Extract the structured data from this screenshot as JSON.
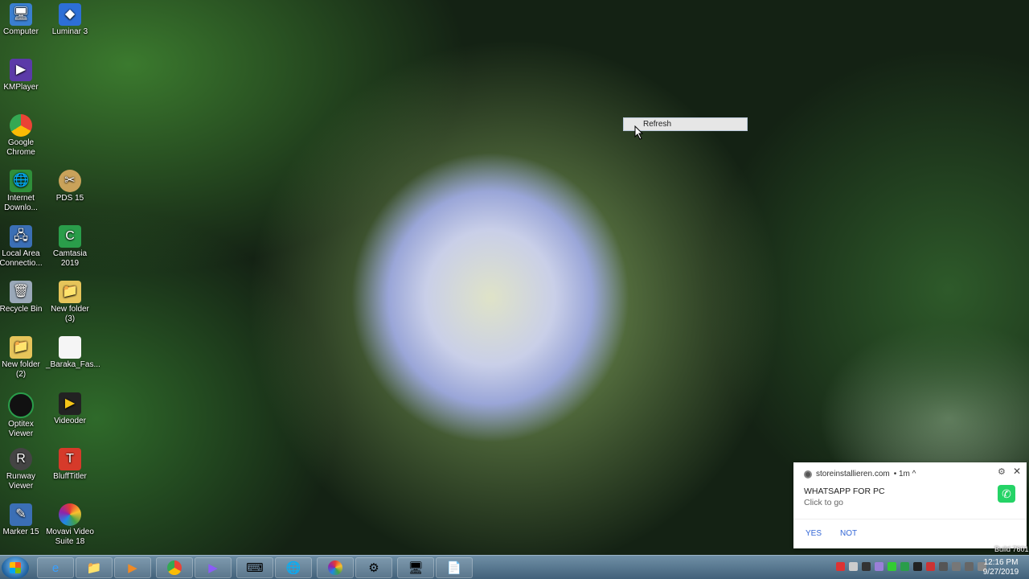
{
  "desktop_icons": [
    {
      "label": "Computer",
      "icon": "computer-icon"
    },
    {
      "label": "Luminar 3",
      "icon": "luminar-icon"
    },
    {
      "label": "KMPlayer",
      "icon": "kmplayer-icon"
    },
    {
      "label": "Google Chrome",
      "icon": "chrome-icon"
    },
    {
      "label": "Internet Downlo...",
      "icon": "idm-icon"
    },
    {
      "label": "PDS 15",
      "icon": "pds-icon"
    },
    {
      "label": "Local Area Connectio...",
      "icon": "network-icon"
    },
    {
      "label": "Camtasia 2019",
      "icon": "camtasia-icon"
    },
    {
      "label": "Recycle Bin",
      "icon": "recycle-bin-icon"
    },
    {
      "label": "New folder (3)",
      "icon": "folder-icon"
    },
    {
      "label": "New folder (2)",
      "icon": "folder-icon"
    },
    {
      "label": "_Baraka_Fas...",
      "icon": "file-icon"
    },
    {
      "label": "Optitex Viewer",
      "icon": "optitex-icon"
    },
    {
      "label": "Videoder",
      "icon": "videoder-icon"
    },
    {
      "label": "Runway Viewer",
      "icon": "runway-icon"
    },
    {
      "label": "BluffTitler",
      "icon": "blufftitler-icon"
    },
    {
      "label": "Marker 15",
      "icon": "marker-icon"
    },
    {
      "label": "Movavi Video Suite 18",
      "icon": "movavi-icon"
    }
  ],
  "context_menu": {
    "item": "Refresh"
  },
  "notification": {
    "source": "storeinstallieren.com",
    "time": "• 1m ^",
    "title": "WHATSAPP FOR PC",
    "subtitle": "Click to go",
    "yes": "YES",
    "no": "NOT"
  },
  "taskbar": {
    "apps": [
      "explorer-ie-icon",
      "folder-icon",
      "media-player-icon",
      "chrome-icon",
      "vs-icon",
      "keyboard-icon",
      "globe-icon",
      "aperture-icon",
      "control-panel-icon",
      "monitor-icon",
      "document-icon"
    ],
    "time": "12:16 PM",
    "date": "9/27/2019"
  },
  "watermark": "Build 7601"
}
